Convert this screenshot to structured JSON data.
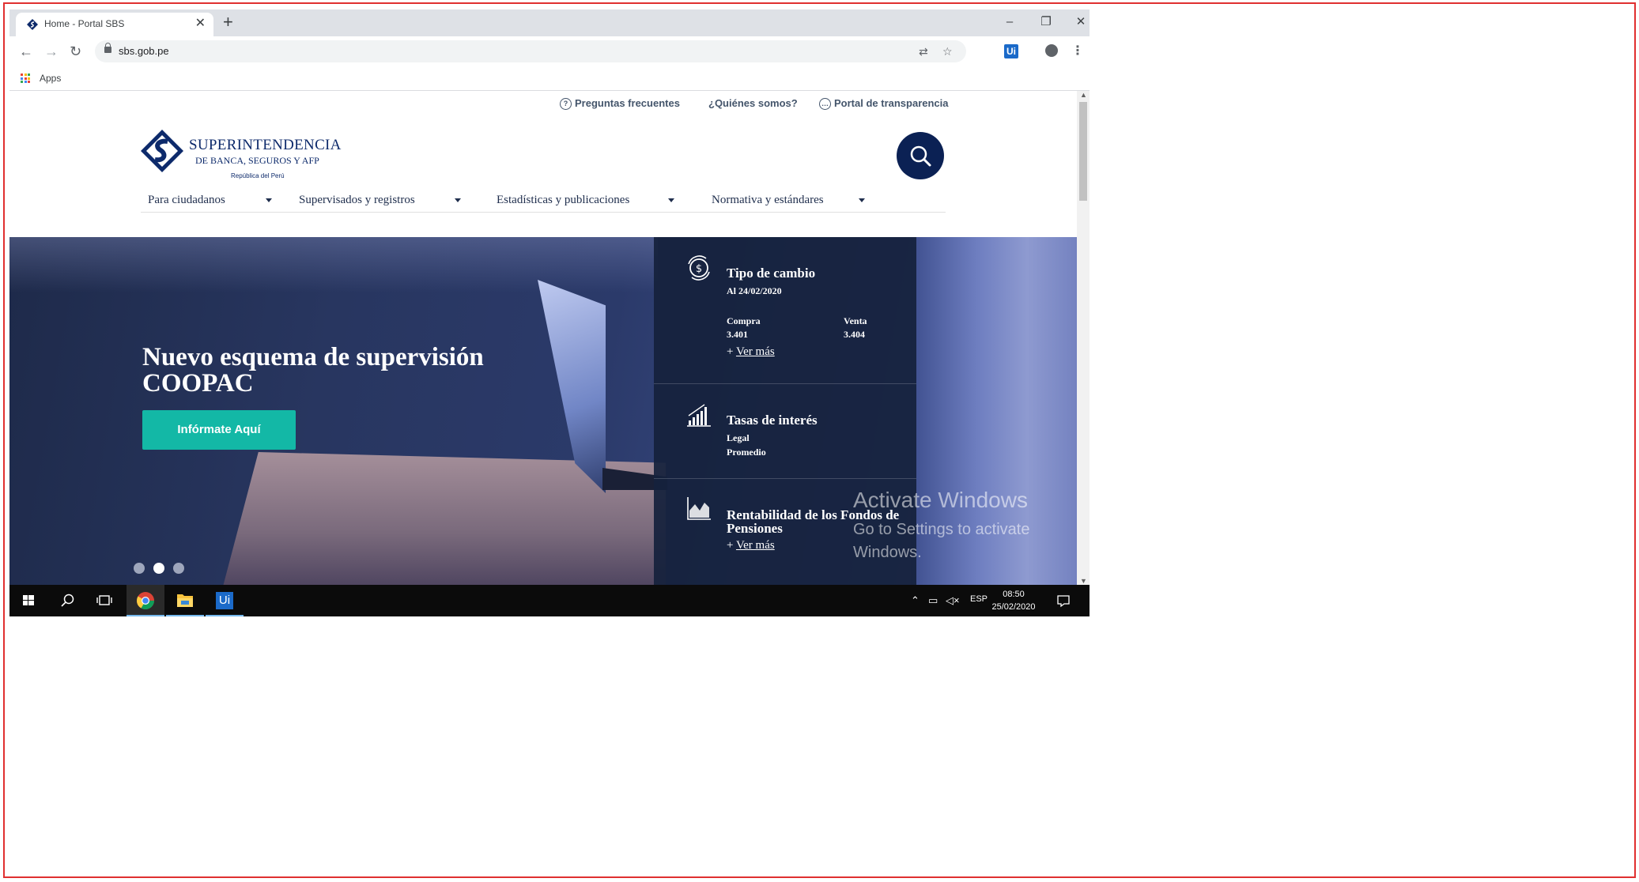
{
  "browser": {
    "tab_title": "Home - Portal SBS",
    "url": "sbs.gob.pe",
    "bookmarks_apps": "Apps",
    "newtab_symbol": "+",
    "tab_close_symbol": "✕",
    "window_controls": {
      "minimize": "–",
      "restore": "❐",
      "close": "✕"
    },
    "extension_label": "Ui"
  },
  "site": {
    "top_links": [
      "Preguntas frecuentes",
      "¿Quiénes somos?",
      "Portal de transparencia"
    ],
    "logo": {
      "line1": "SUPERINTENDENCIA",
      "line2": "DE BANCA, SEGUROS Y AFP",
      "line3": "República del Perú"
    },
    "menu": [
      "Para ciudadanos",
      "Supervisados y registros",
      "Estadísticas y publicaciones",
      "Normativa y estándares"
    ]
  },
  "hero": {
    "title": "Nuevo esquema de supervisión COOPAC",
    "cta": "Infórmate Aquí",
    "slides": 3,
    "active_slide": 2
  },
  "panel": {
    "exchange": {
      "title": "Tipo de cambio",
      "date": "Al 24/02/2020",
      "buy_label": "Compra",
      "buy_value": "3.401",
      "sell_label": "Venta",
      "sell_value": "3.404",
      "more": "Ver más",
      "icon": "dollar-exchange-icon"
    },
    "rates": {
      "title": "Tasas de interés",
      "line1": "Legal",
      "line2": "Promedio",
      "icon": "bar-chart-icon"
    },
    "pensions": {
      "title": "Rentabilidad de los Fondos de Pensiones",
      "more": "Ver más",
      "icon": "area-chart-icon"
    },
    "link_prefix": "+"
  },
  "watermark": {
    "line1": "Activate Windows",
    "line2": "Go to Settings to activate Windows."
  },
  "taskbar": {
    "language": "ESP",
    "time": "08:50",
    "date": "25/02/2020",
    "uipath_label": "Ui"
  },
  "colors": {
    "brand_navy": "#0b2154",
    "cta_teal": "#13b8a6",
    "frame_red": "#e03030"
  }
}
